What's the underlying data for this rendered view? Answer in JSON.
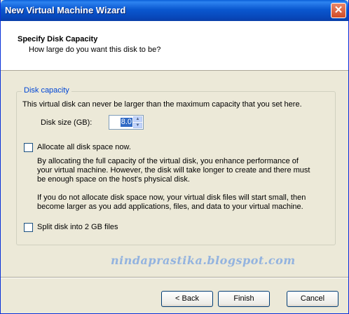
{
  "window": {
    "title": "New Virtual Machine Wizard",
    "close_glyph": "✕"
  },
  "header": {
    "title": "Specify Disk Capacity",
    "subtitle": "How large do you want this disk to be?"
  },
  "disk_capacity": {
    "group_label": "Disk capacity",
    "description": "This virtual disk can never be larger than the maximum capacity that you set here.",
    "size_label": "Disk size (GB):",
    "size_value": "8.0"
  },
  "allocate": {
    "label": "Allocate all disk space now.",
    "checked": false,
    "para1": [
      "By allocating the full capacity of the virtual disk, you enhance performance of",
      "your virtual machine.  However, the disk will take longer to create and there must",
      "be enough space on the host's physical disk."
    ],
    "para2": [
      "If you do not allocate disk space now, your virtual disk files will start small, then",
      "become larger as you add applications, files, and data to your virtual machine."
    ]
  },
  "split": {
    "label": "Split disk into 2 GB files",
    "checked": false
  },
  "watermark": "nindaprastika.blogspot.com",
  "buttons": {
    "back": "< Back",
    "finish": "Finish",
    "cancel": "Cancel"
  },
  "icons": {
    "close": "close-icon",
    "spin_up": "up-arrow-icon",
    "spin_down": "down-arrow-icon"
  },
  "colors": {
    "titlebar": "#0a58d0",
    "group_label": "#0046d5",
    "selection": "#316ac5"
  }
}
